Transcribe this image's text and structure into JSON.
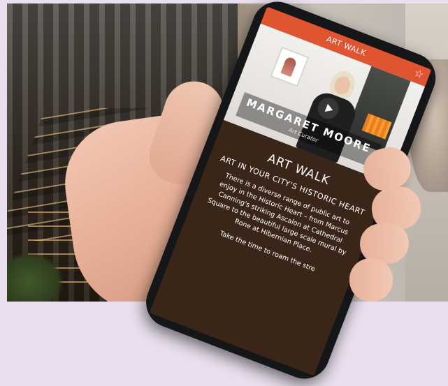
{
  "app": {
    "header_title": "ART WALK",
    "favorite_icon": "star-icon",
    "accent_color": "#e0542f"
  },
  "video": {
    "presenter_name": "MARGARET MOORE",
    "presenter_role": "Art Curator",
    "play_icon": "play-icon"
  },
  "content": {
    "heading": "ART WALK",
    "subheading": "ART IN YOUR CITY'S HISTORIC HEART",
    "paragraph": "There is a diverse range of public art to enjoy in the Historic Heart – from Marcus Canning's striking Ascalon at Cathedral Square to the beautiful large scale mural by Rone at Hibernian Place.",
    "paragraph2": "Take the time to roam the stre",
    "background_color": "#3a2619"
  }
}
